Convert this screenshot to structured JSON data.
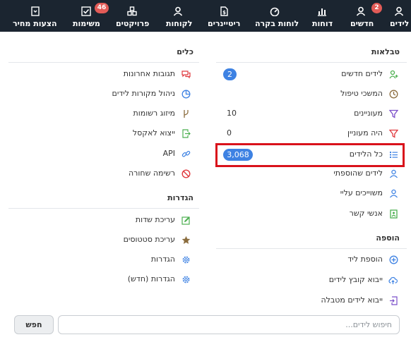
{
  "nav": {
    "items": [
      {
        "label": "לידים",
        "icon": "person-icon"
      },
      {
        "label": "חדשים",
        "icon": "person-icon",
        "badge": "2"
      },
      {
        "label": "דוחות",
        "icon": "bar-chart-icon"
      },
      {
        "label": "לוחות בקרה",
        "icon": "gauge-icon"
      },
      {
        "label": "ריטיינרים",
        "icon": "invoice-dollar-icon"
      },
      {
        "label": "לקוחות",
        "icon": "person-icon"
      },
      {
        "label": "פרויקטים",
        "icon": "cubes-icon"
      },
      {
        "label": "משימות",
        "icon": "checkbox-icon",
        "badge": "46"
      },
      {
        "label": "הצעות מחיר",
        "icon": "document-icon"
      }
    ]
  },
  "tables": {
    "title": "טבלאות",
    "rows": [
      {
        "label": "לידים חדשים",
        "icon": "person-plus-icon",
        "count": "2"
      },
      {
        "label": "המשכי טיפול",
        "icon": "clock-icon"
      },
      {
        "label": "מעוניינים",
        "icon": "filter-icon",
        "count": "10"
      },
      {
        "label": "היה מעוניין",
        "icon": "filter-icon",
        "count": "0"
      },
      {
        "label": "כל הלידים",
        "icon": "list-icon",
        "count": "3,068"
      },
      {
        "label": "לידים שהוספתי",
        "icon": "person-icon"
      },
      {
        "label": "משוייכים עליי",
        "icon": "person-icon"
      },
      {
        "label": "אנשי קשר",
        "icon": "contact-card-icon"
      }
    ]
  },
  "add": {
    "title": "הוספה",
    "rows": [
      {
        "label": "הוספת ליד",
        "icon": "plus-circle-icon"
      },
      {
        "label": "ייבוא קובץ לידים",
        "icon": "cloud-upload-icon"
      },
      {
        "label": "ייבוא לידים מטבלה",
        "icon": "import-icon"
      }
    ]
  },
  "tools": {
    "title": "כלים",
    "rows": [
      {
        "label": "תגובות אחרונות",
        "icon": "comments-icon"
      },
      {
        "label": "ניהול מקורות לידים",
        "icon": "pie-chart-icon"
      },
      {
        "label": "מיזוג רשומות",
        "icon": "merge-icon"
      },
      {
        "label": "ייצוא לאקסל",
        "icon": "export-icon"
      },
      {
        "label": "API",
        "icon": "link-icon"
      },
      {
        "label": "רשימה שחורה",
        "icon": "ban-icon"
      }
    ]
  },
  "settings": {
    "title": "הגדרות",
    "rows": [
      {
        "label": "עריכת שדות",
        "icon": "edit-icon"
      },
      {
        "label": "עריכת סטטוסים",
        "icon": "star-icon"
      },
      {
        "label": "הגדרות",
        "icon": "gear-icon"
      },
      {
        "label": "הגדרות (חדש)",
        "icon": "gear-icon"
      }
    ]
  },
  "search": {
    "placeholder": "חיפוש לידים...",
    "button_label": "חפש"
  },
  "colors": {
    "nav_bg": "#1b2530",
    "badge": "#e25b57",
    "pill": "#3e82e3",
    "highlight": "#d9121b"
  }
}
